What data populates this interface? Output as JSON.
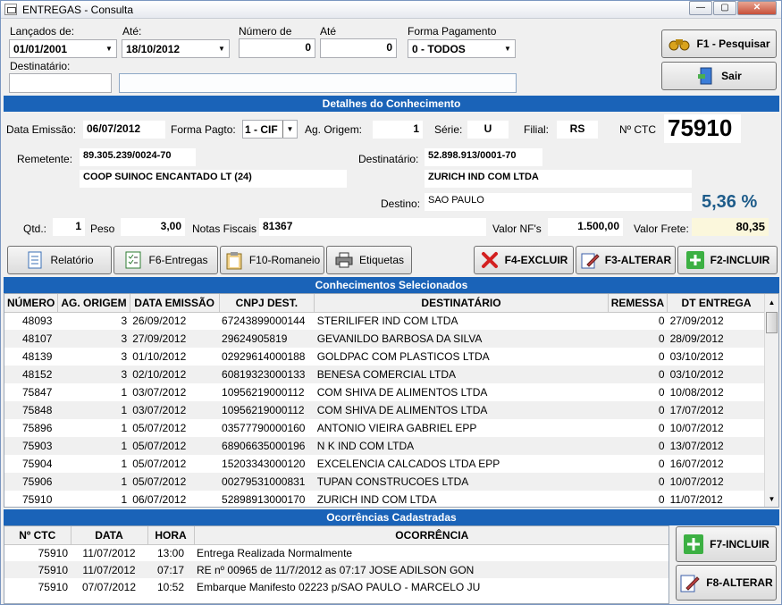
{
  "window": {
    "title": "ENTREGAS - Consulta"
  },
  "filters": {
    "lancados_label": "Lançados de:",
    "lancados_value": "01/01/2001",
    "ate_label": "Até:",
    "ate_value": "18/10/2012",
    "numero_label": "Número de",
    "numero_value": "0",
    "ate2_label": "Até",
    "ate2_value": "0",
    "forma_label": "Forma Pagamento",
    "forma_value": "0 - TODOS",
    "destinatario_label": "Destinatário:",
    "destinatario_code": "",
    "destinatario_name": ""
  },
  "actions": {
    "pesquisar": "F1 - Pesquisar",
    "sair": "Sair"
  },
  "detalhes": {
    "header": "Detalhes do Conhecimento",
    "data_emissao_label": "Data Emissão:",
    "data_emissao": "06/07/2012",
    "forma_pagto_label": "Forma Pagto:",
    "forma_pagto": "1 - CIF",
    "ag_origem_label": "Ag. Origem:",
    "ag_origem": "1",
    "serie_label": "Série:",
    "serie": "U",
    "filial_label": "Filial:",
    "filial": "RS",
    "ctc_label": "Nº CTC",
    "ctc": "75910",
    "remetente_label": "Remetente:",
    "remetente_cnpj": "89.305.239/0024-70",
    "remetente_nome": "COOP SUINOC ENCANTADO LT (24)",
    "destinatario_label": "Destinatário:",
    "destinatario_cnpj": "52.898.913/0001-70",
    "destinatario_nome": "ZURICH IND COM LTDA",
    "destino_label": "Destino:",
    "destino": "SAO PAULO",
    "percent": "5,36 %",
    "qtd_label": "Qtd.:",
    "qtd": "1",
    "peso_label": "Peso",
    "peso": "3,00",
    "notas_label": "Notas Fiscais",
    "notas": "81367",
    "valor_nf_label": "Valor NF's",
    "valor_nf": "1.500,00",
    "valor_frete_label": "Valor Frete:",
    "valor_frete": "80,35"
  },
  "toolbar": {
    "relatorio": "Relatório",
    "entregas": "F6-Entregas",
    "romaneio": "F10-Romaneio",
    "etiquetas": "Etiquetas",
    "excluir": "F4-EXCLUIR",
    "alterar": "F3-ALTERAR",
    "incluir": "F2-INCLUIR"
  },
  "conhecimentos": {
    "header": "Conhecimentos Selecionados",
    "columns": [
      "NÚMERO",
      "AG. ORIGEM",
      "DATA EMISSÃO",
      "CNPJ DEST.",
      "DESTINATÁRIO",
      "REMESSA",
      "DT ENTREGA"
    ],
    "rows": [
      [
        "48093",
        "3",
        "26/09/2012",
        "67243899000144",
        "STERILIFER IND COM LTDA",
        "0",
        "27/09/2012"
      ],
      [
        "48107",
        "3",
        "27/09/2012",
        "29624905819",
        "GEVANILDO BARBOSA DA SILVA",
        "0",
        "28/09/2012"
      ],
      [
        "48139",
        "3",
        "01/10/2012",
        "02929614000188",
        "GOLDPAC COM PLASTICOS LTDA",
        "0",
        "03/10/2012"
      ],
      [
        "48152",
        "3",
        "02/10/2012",
        "60819323000133",
        "BENESA COMERCIAL LTDA",
        "0",
        "03/10/2012"
      ],
      [
        "75847",
        "1",
        "03/07/2012",
        "10956219000112",
        "COM SHIVA DE ALIMENTOS LTDA",
        "0",
        "10/08/2012"
      ],
      [
        "75848",
        "1",
        "03/07/2012",
        "10956219000112",
        "COM SHIVA DE ALIMENTOS LTDA",
        "0",
        "17/07/2012"
      ],
      [
        "75896",
        "1",
        "05/07/2012",
        "03577790000160",
        "ANTONIO VIEIRA GABRIEL EPP",
        "0",
        "10/07/2012"
      ],
      [
        "75903",
        "1",
        "05/07/2012",
        "68906635000196",
        "N K IND COM LTDA",
        "0",
        "13/07/2012"
      ],
      [
        "75904",
        "1",
        "05/07/2012",
        "15203343000120",
        "EXCELENCIA CALCADOS LTDA EPP",
        "0",
        "16/07/2012"
      ],
      [
        "75906",
        "1",
        "05/07/2012",
        "00279531000831",
        "TUPAN CONSTRUCOES LTDA",
        "0",
        "10/07/2012"
      ],
      [
        "75910",
        "1",
        "06/07/2012",
        "52898913000170",
        "ZURICH IND COM LTDA",
        "0",
        "11/07/2012"
      ]
    ]
  },
  "ocorrencias": {
    "header": "Ocorrências Cadastradas",
    "columns": [
      "Nº CTC",
      "DATA",
      "HORA",
      "OCORRÊNCIA"
    ],
    "rows": [
      [
        "75910",
        "11/07/2012",
        "13:00",
        "Entrega Realizada Normalmente"
      ],
      [
        "75910",
        "11/07/2012",
        "07:17",
        "RE nº 00965 de 11/7/2012 as 07:17 JOSE ADILSON GON"
      ],
      [
        "75910",
        "07/07/2012",
        "10:52",
        "Embarque Manifesto 02223 p/SAO PAULO - MARCELO JU"
      ]
    ],
    "incluir": "F7-INCLUIR",
    "alterar": "F8-ALTERAR"
  },
  "colors": {
    "section": "#1a63b8",
    "percent": "#1e5c8a",
    "frete_bg": "#fbf7dc"
  }
}
